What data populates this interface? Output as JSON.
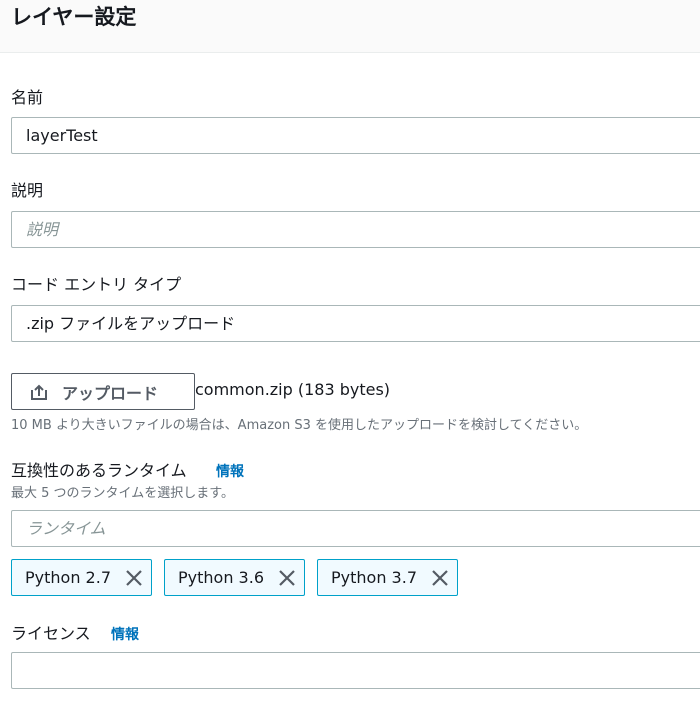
{
  "header": {
    "title": "レイヤー設定"
  },
  "form": {
    "name": {
      "label": "名前",
      "value": "layerTest"
    },
    "description": {
      "label": "説明",
      "placeholder": "説明"
    },
    "code_entry": {
      "label": "コード エントリ タイプ",
      "value": ".zip ファイルをアップロード"
    },
    "upload": {
      "button_label": "アップロード",
      "file_info": "common.zip (183 bytes)",
      "hint": "10 MB より大きいファイルの場合は、Amazon S3 を使用したアップロードを検討してください。"
    },
    "runtimes": {
      "label": "互換性のあるランタイム",
      "info_link": "情報",
      "hint": "最大 5 つのランタイムを選択します。",
      "placeholder": "ランタイム",
      "selected": [
        "Python 2.7",
        "Python 3.6",
        "Python 3.7"
      ]
    },
    "license": {
      "label": "ライセンス",
      "info_link": "情報",
      "value": ""
    }
  }
}
